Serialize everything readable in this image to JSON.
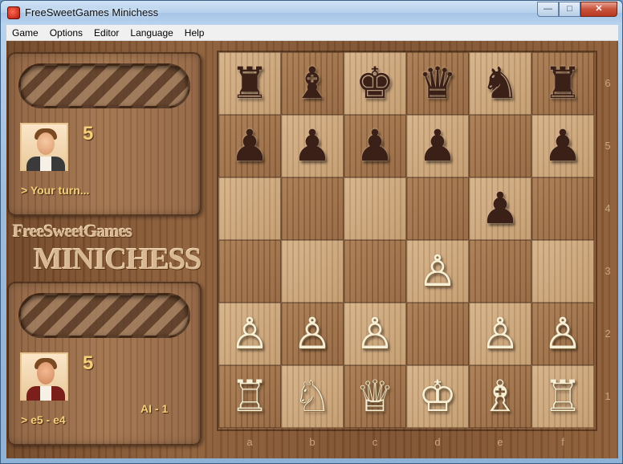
{
  "window": {
    "title": "FreeSweetGames Minichess",
    "buttons": {
      "minimize": "—",
      "maximize": "□",
      "close": "✕"
    }
  },
  "menu": [
    "Game",
    "Options",
    "Editor",
    "Language",
    "Help"
  ],
  "top_player": {
    "score": "5",
    "status": "> Your turn..."
  },
  "bottom_player": {
    "score": "5",
    "status": "> e5 - e4",
    "ai_label": "AI - 1"
  },
  "logo": {
    "line1": "FreeSweetGames",
    "line2": "MINICHESS"
  },
  "board": {
    "ranks": [
      "6",
      "5",
      "4",
      "3",
      "2",
      "1"
    ],
    "files": [
      "a",
      "b",
      "c",
      "d",
      "e",
      "f"
    ],
    "rows": [
      [
        {
          "p": "♜",
          "c": "black",
          "n": "rook"
        },
        {
          "p": "♝",
          "c": "black",
          "n": "bishop"
        },
        {
          "p": "♚",
          "c": "black",
          "n": "king"
        },
        {
          "p": "♛",
          "c": "black",
          "n": "queen"
        },
        {
          "p": "♞",
          "c": "black",
          "n": "knight"
        },
        {
          "p": "♜",
          "c": "black",
          "n": "rook"
        }
      ],
      [
        {
          "p": "♟",
          "c": "black",
          "n": "pawn"
        },
        {
          "p": "♟",
          "c": "black",
          "n": "pawn"
        },
        {
          "p": "♟",
          "c": "black",
          "n": "pawn"
        },
        {
          "p": "♟",
          "c": "black",
          "n": "pawn"
        },
        null,
        {
          "p": "♟",
          "c": "black",
          "n": "pawn"
        }
      ],
      [
        null,
        null,
        null,
        null,
        {
          "p": "♟",
          "c": "black",
          "n": "pawn"
        },
        null
      ],
      [
        null,
        null,
        null,
        {
          "p": "♙",
          "c": "white",
          "n": "pawn"
        },
        null,
        null
      ],
      [
        {
          "p": "♙",
          "c": "white",
          "n": "pawn"
        },
        {
          "p": "♙",
          "c": "white",
          "n": "pawn"
        },
        {
          "p": "♙",
          "c": "white",
          "n": "pawn"
        },
        null,
        {
          "p": "♙",
          "c": "white",
          "n": "pawn"
        },
        {
          "p": "♙",
          "c": "white",
          "n": "pawn"
        }
      ],
      [
        {
          "p": "♖",
          "c": "white",
          "n": "rook"
        },
        {
          "p": "♘",
          "c": "white",
          "n": "knight"
        },
        {
          "p": "♕",
          "c": "white",
          "n": "queen"
        },
        {
          "p": "♔",
          "c": "white",
          "n": "king"
        },
        {
          "p": "♗",
          "c": "white",
          "n": "bishop"
        },
        {
          "p": "♖",
          "c": "white",
          "n": "rook"
        }
      ]
    ]
  }
}
